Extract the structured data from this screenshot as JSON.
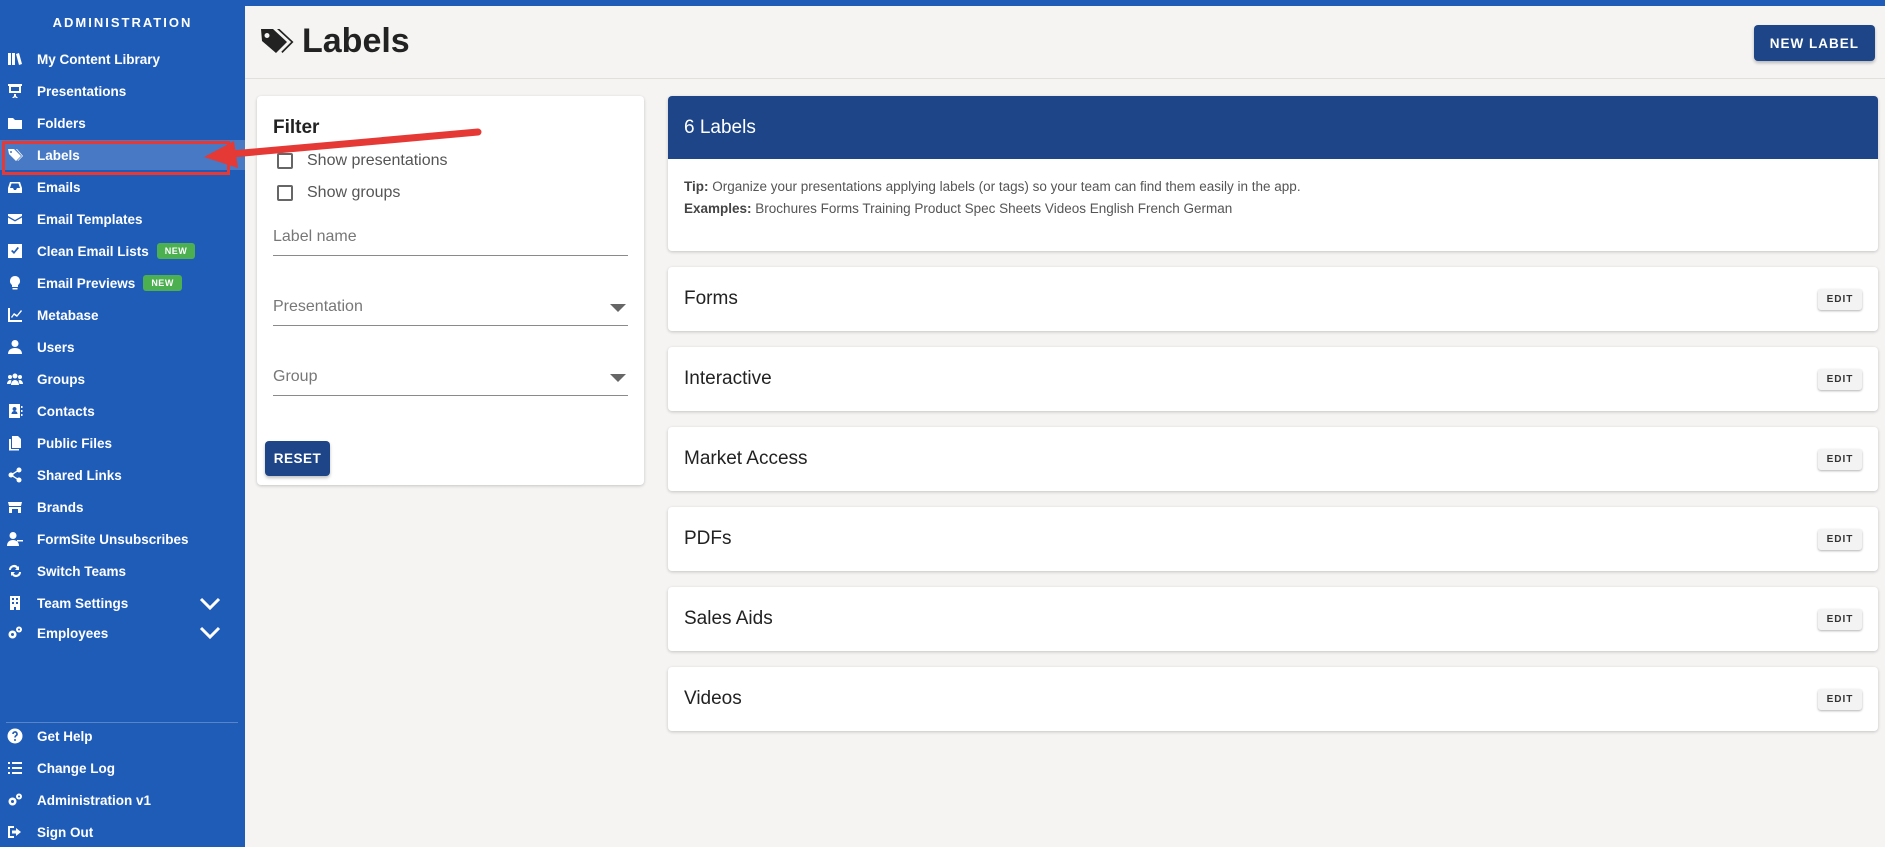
{
  "sidebar": {
    "title": "ADMINISTRATION",
    "items": [
      {
        "label": "My Content Library",
        "icon": "library-icon"
      },
      {
        "label": "Presentations",
        "icon": "presentation-icon"
      },
      {
        "label": "Folders",
        "icon": "folder-icon"
      },
      {
        "label": "Labels",
        "icon": "tags-icon",
        "active": true
      },
      {
        "label": "Emails",
        "icon": "inbox-icon"
      },
      {
        "label": "Email Templates",
        "icon": "envelope-icon"
      },
      {
        "label": "Clean Email Lists",
        "icon": "checkbox-icon",
        "badge": "NEW"
      },
      {
        "label": "Email Previews",
        "icon": "lightbulb-icon",
        "badge": "NEW"
      },
      {
        "label": "Metabase",
        "icon": "chart-line-icon"
      },
      {
        "label": "Users",
        "icon": "user-icon"
      },
      {
        "label": "Groups",
        "icon": "users-icon"
      },
      {
        "label": "Contacts",
        "icon": "address-book-icon"
      },
      {
        "label": "Public Files",
        "icon": "files-icon"
      },
      {
        "label": "Shared Links",
        "icon": "share-icon"
      },
      {
        "label": "Brands",
        "icon": "store-icon"
      },
      {
        "label": "FormSite Unsubscribes",
        "icon": "user-minus-icon"
      },
      {
        "label": "Switch Teams",
        "icon": "switch-icon"
      },
      {
        "label": "Team Settings",
        "icon": "building-icon"
      },
      {
        "label": "Employees",
        "icon": "cogs-icon"
      }
    ],
    "bottom_items": [
      {
        "label": "Get Help",
        "icon": "help-icon"
      },
      {
        "label": "Change Log",
        "icon": "list-icon"
      },
      {
        "label": "Administration v1",
        "icon": "cogs-icon"
      },
      {
        "label": "Sign Out",
        "icon": "sign-out-icon"
      }
    ]
  },
  "header": {
    "title": "Labels",
    "new_label_button": "NEW LABEL"
  },
  "filter": {
    "title": "Filter",
    "show_presentations": "Show presentations",
    "show_groups": "Show groups",
    "label_name_placeholder": "Label name",
    "presentation_placeholder": "Presentation",
    "group_placeholder": "Group",
    "reset_button": "RESET"
  },
  "labels_panel": {
    "count_title": "6 Labels",
    "tip_prefix": "Tip:",
    "tip_text": " Organize your presentations applying labels (or tags) so your team can find them easily in the app.",
    "examples_prefix": "Examples:",
    "examples_text": " Brochures Forms Training Product Spec Sheets Videos English French German",
    "edit_label": "EDIT",
    "labels": [
      "Forms",
      "Interactive",
      "Market Access",
      "PDFs",
      "Sales Aids",
      "Videos"
    ]
  },
  "colors": {
    "sidebar_bg": "#1f5cb8",
    "primary_dark": "#1d4587",
    "badge_green": "#4caf50",
    "annotation_red": "#e53935"
  }
}
